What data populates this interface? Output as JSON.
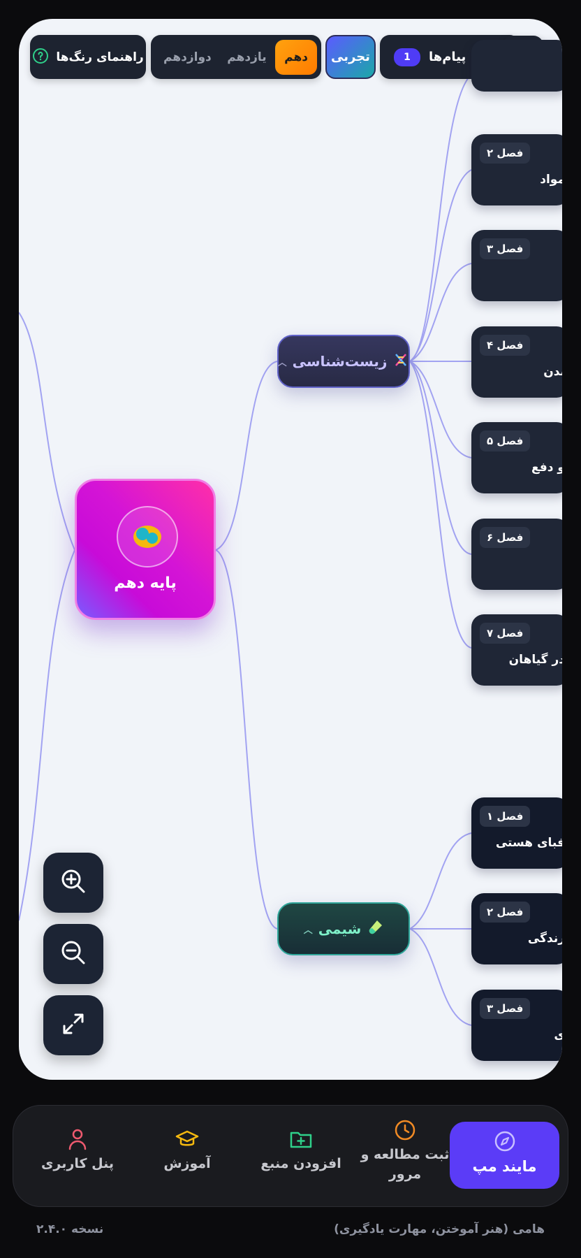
{
  "header": {
    "color_guide_label": "راهنمای رنگ‌ها",
    "grades": [
      "دهم",
      "یازدهم",
      "دوازدهم"
    ],
    "active_grade": "دهم",
    "track_label": "تجربی",
    "messages_label": "پیام‌ها",
    "messages_count": "1"
  },
  "mindmap": {
    "center_label": "پایه دهم",
    "subjects": [
      {
        "label": "زیست‌شناسی",
        "icon": "dna-icon",
        "color": "#6062c8"
      },
      {
        "label": "شیمی",
        "icon": "test-tube-icon",
        "color": "#2fa69a"
      }
    ],
    "biology_chapters": [
      {
        "chip": "",
        "title": ""
      },
      {
        "chip": "فصل ۲",
        "title": "مواد"
      },
      {
        "chip": "فصل ۳",
        "title": ""
      },
      {
        "chip": "فصل ۴",
        "title": "بدن"
      },
      {
        "chip": "فصل ۵",
        "title": "و دفع"
      },
      {
        "chip": "فصل ۶",
        "title": ""
      },
      {
        "chip": "فصل ۷",
        "title": "در گیاهان"
      }
    ],
    "chemistry_chapters": [
      {
        "chip": "فصل ۱",
        "title": "فبای هستی"
      },
      {
        "chip": "فصل ۲",
        "title": "زندگی"
      },
      {
        "chip": "فصل ۳",
        "title": "ی"
      }
    ]
  },
  "zoom": {
    "in_icon": "zoom-in-icon",
    "out_icon": "zoom-out-icon",
    "fit_icon": "expand-icon"
  },
  "bottom_nav": {
    "items": [
      {
        "label": "پنل کاربری",
        "icon": "user-icon",
        "color": "#ef5a6f"
      },
      {
        "label": "آموزش",
        "icon": "graduation-cap-icon",
        "color": "#f5b90f"
      },
      {
        "label": "افزودن منبع",
        "icon": "folder-plus-icon",
        "color": "#2fd08a"
      },
      {
        "label": "ثبت مطالعه و مرور",
        "icon": "clock-icon",
        "color": "#f08a24"
      },
      {
        "label": "مایند مپ",
        "icon": "compass-icon",
        "color": "#ffffff"
      }
    ],
    "active": "مایند مپ"
  },
  "footer": {
    "version": "نسخه ۲.۴.۰",
    "tagline": "هامی (هنر آموختن، مهارت یادگیری)"
  }
}
